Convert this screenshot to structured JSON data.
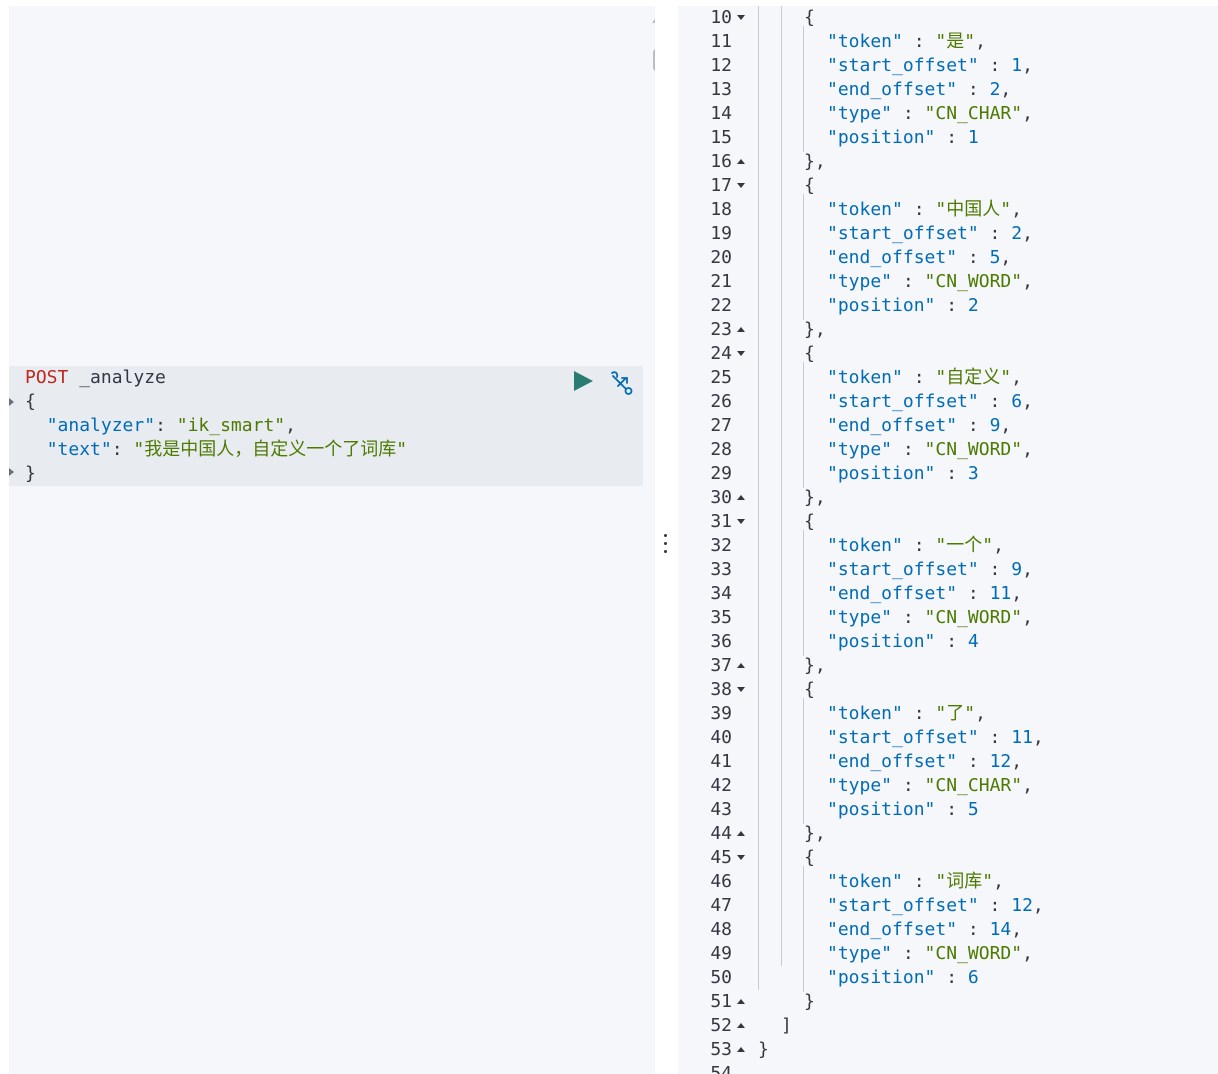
{
  "request": {
    "method": "POST",
    "path": "_analyze",
    "open_brace": "{",
    "analyzer_key": "\"analyzer\"",
    "analyzer_value": "\"ik_smart\"",
    "text_key": "\"text\"",
    "text_value": "\"我是中国人，自定义一个了词库\"",
    "close_brace": "}",
    "run_icon": "play-icon",
    "settings_icon": "wrench-icon"
  },
  "response": {
    "first_visible_line": 10,
    "last_partial_line": "54",
    "keys": {
      "token": "\"token\"",
      "start_offset": "\"start_offset\"",
      "end_offset": "\"end_offset\"",
      "type": "\"type\"",
      "position": "\"position\""
    },
    "tokens": [
      {
        "token": "\"是\"",
        "start_offset": "1",
        "end_offset": "2",
        "type": "\"CN_CHAR\"",
        "position": "1"
      },
      {
        "token": "\"中国人\"",
        "start_offset": "2",
        "end_offset": "5",
        "type": "\"CN_WORD\"",
        "position": "2"
      },
      {
        "token": "\"自定义\"",
        "start_offset": "6",
        "end_offset": "9",
        "type": "\"CN_WORD\"",
        "position": "3"
      },
      {
        "token": "\"一个\"",
        "start_offset": "9",
        "end_offset": "11",
        "type": "\"CN_WORD\"",
        "position": "4"
      },
      {
        "token": "\"了\"",
        "start_offset": "11",
        "end_offset": "12",
        "type": "\"CN_CHAR\"",
        "position": "5"
      },
      {
        "token": "\"词库\"",
        "start_offset": "12",
        "end_offset": "14",
        "type": "\"CN_WORD\"",
        "position": "6"
      }
    ]
  }
}
